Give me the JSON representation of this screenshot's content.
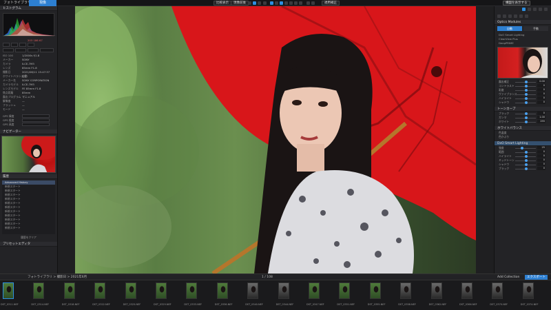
{
  "colors": {
    "accent": "#2d7fd1",
    "umbrella": "#d41a1a",
    "panel": "#232326"
  },
  "topbar": {
    "tab_library": "フォトライブラリ",
    "tab_develop": "現像",
    "filter_label": "比較表示",
    "compare_label": "現像前後",
    "reset_label": "適用補正",
    "export_label": "構図を表示する",
    "icons": [
      "grid-icon",
      "compare-icon",
      "crop-icon",
      "eye-icon",
      "repair-icon",
      "brush-icon",
      "gradient-icon",
      "radial-icon",
      "white-balance-icon",
      "redeye-icon",
      "zoom-icon"
    ]
  },
  "left": {
    "histogram_title": "ヒストグラム",
    "histogram_readout": "203  186  67",
    "exif_rows": [
      {
        "k": "ISO 100",
        "v": "1/2000s f/1.8"
      },
      {
        "k": "メーカー",
        "v": "SONY"
      },
      {
        "k": "カメラ",
        "v": "ILCE-7M3"
      },
      {
        "k": "レンズ",
        "v": "85mm F1.8"
      },
      {
        "k": "撮影日",
        "v": "2021/06/11 15:47:37"
      },
      {
        "k": "ホワイトバランス",
        "v": "自動"
      },
      {
        "k": "メーカー名",
        "v": "SONY CORPORATION"
      },
      {
        "k": "カメラモデル",
        "v": "ILCE-7M3"
      },
      {
        "k": "レンズモデル",
        "v": "FE 85mm F1.8"
      },
      {
        "k": "焦点距離",
        "v": "85mm"
      },
      {
        "k": "露出プログラム",
        "v": "マニュアル"
      },
      {
        "k": "解像度",
        "v": "—"
      },
      {
        "k": "フラッシュ",
        "v": "—"
      },
      {
        "k": "モード",
        "v": "—"
      }
    ],
    "gps": [
      {
        "k": "GPS 緯度",
        "v": ""
      },
      {
        "k": "GPS 経度",
        "v": ""
      },
      {
        "k": "GPS 高度",
        "v": ""
      }
    ],
    "navigator_title": "ナビゲーター",
    "history_title": "履歴",
    "history_items": [
      "Advanced History",
      "新規スタート",
      "新規スタート",
      "新規スタート",
      "新規スタート",
      "新規スタート",
      "新規スタート",
      "新規スタート",
      "新規スタート",
      "新規スタート",
      "新規スタート",
      "新規スタート"
    ],
    "history_footer": "履歴をクリア",
    "apply_title": "プリセットエディタ"
  },
  "right": {
    "lens_title": "Optics Modules",
    "lens_tabs": [
      "自動",
      "手動"
    ],
    "lens_items": [
      "DxO Smart Lighting",
      "ClearView Plus",
      "DeepPRIME"
    ],
    "sliders": [
      {
        "label": "露出補正",
        "value": "0.00",
        "pos": 0.5
      },
      {
        "label": "コントラスト",
        "value": "0",
        "pos": 0.5
      },
      {
        "label": "彩度",
        "value": "0",
        "pos": 0.5
      },
      {
        "label": "ヴァイブランス",
        "value": "0",
        "pos": 0.5
      },
      {
        "label": "ハイライト",
        "value": "0",
        "pos": 0.5
      },
      {
        "label": "シャドウ",
        "value": "0",
        "pos": 0.5
      }
    ],
    "tone_title": "トーンカーブ",
    "sliders2": [
      {
        "label": "ブラック",
        "value": "0",
        "pos": 0.5
      },
      {
        "label": "ガンマ",
        "value": "1.00",
        "pos": 0.5
      },
      {
        "label": "ホワイト",
        "value": "255",
        "pos": 0.5
      }
    ],
    "wb_title": "ホワイトバランス",
    "wb_items": [
      "色温度",
      "色かぶり"
    ],
    "dxo_title": "DxO Smart Lighting",
    "sliders3": [
      {
        "label": "強度",
        "value": "25",
        "pos": 0.3
      },
      {
        "label": "範囲",
        "value": "0",
        "pos": 0.5
      },
      {
        "label": "ハイライト",
        "value": "0",
        "pos": 0.5
      },
      {
        "label": "ミッドトーン",
        "value": "0",
        "pos": 0.5
      },
      {
        "label": "シャドウ",
        "value": "0",
        "pos": 0.5
      },
      {
        "label": "ブラック",
        "value": "0",
        "pos": 0.5
      }
    ]
  },
  "filmstrip": {
    "path": "フォトライブラリ > 撮影日 > 2021年6月",
    "count": "1 / 108",
    "collection_label": "Add Collection",
    "export_label": "エクスポート",
    "items": [
      {
        "name": "DST_0311.NEF",
        "type": "green"
      },
      {
        "name": "DST_0314.NEF",
        "type": "green"
      },
      {
        "name": "DST_0318.NEF",
        "type": "green"
      },
      {
        "name": "DST_0322.NEF",
        "type": "green"
      },
      {
        "name": "DST_0325.NEF",
        "type": "green"
      },
      {
        "name": "DST_0329.NEF",
        "type": "green"
      },
      {
        "name": "DST_0333.NEF",
        "type": "green"
      },
      {
        "name": "DST_0336.NEF",
        "type": "green"
      },
      {
        "name": "DST_0340.NEF",
        "type": "dark"
      },
      {
        "name": "DST_0344.NEF",
        "type": "dark"
      },
      {
        "name": "DST_0347.NEF",
        "type": "green"
      },
      {
        "name": "DST_0351.NEF",
        "type": "green"
      },
      {
        "name": "DST_0355.NEF",
        "type": "green"
      },
      {
        "name": "DST_0358.NEF",
        "type": "dark"
      },
      {
        "name": "DST_0362.NEF",
        "type": "dark"
      },
      {
        "name": "DST_0366.NEF",
        "type": "dark"
      },
      {
        "name": "DST_0370.NEF",
        "type": "dark"
      },
      {
        "name": "DST_0374.NEF",
        "type": "dark"
      }
    ]
  }
}
